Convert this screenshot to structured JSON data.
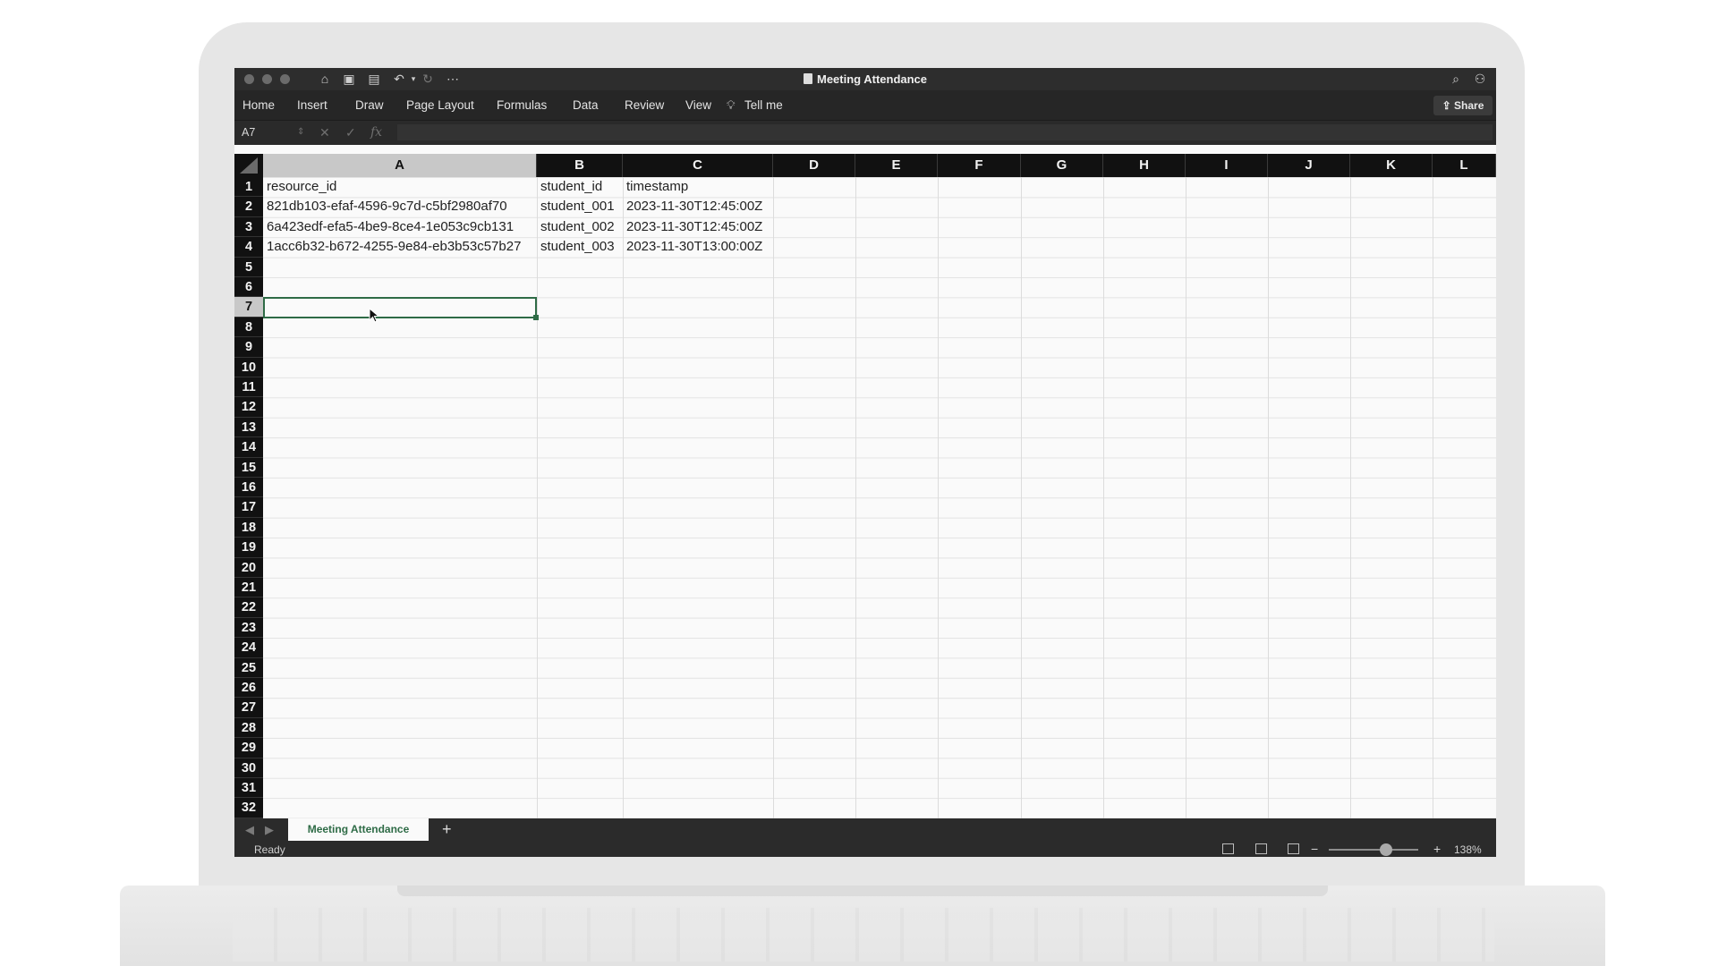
{
  "window": {
    "title": "Meeting Attendance"
  },
  "ribbon": {
    "tabs": [
      "Home",
      "Insert",
      "Draw",
      "Page Layout",
      "Formulas",
      "Data",
      "Review",
      "View"
    ],
    "tell_me": "Tell me",
    "share": "Share"
  },
  "formula_bar": {
    "name_box": "A7",
    "fx": "fx",
    "value": ""
  },
  "columns": [
    "A",
    "B",
    "C",
    "D",
    "E",
    "F",
    "G",
    "H",
    "I",
    "J",
    "K",
    "L"
  ],
  "selected_column": "A",
  "rows": [
    "1",
    "2",
    "3",
    "4",
    "5",
    "6",
    "7",
    "8",
    "9",
    "10",
    "11",
    "12",
    "13",
    "14",
    "15",
    "16",
    "17",
    "18",
    "19",
    "20",
    "21",
    "22",
    "23",
    "24",
    "25",
    "26",
    "27",
    "28",
    "29",
    "30",
    "31",
    "32"
  ],
  "selected_row": "7",
  "cells": {
    "A1": "resource_id",
    "B1": "student_id",
    "C1": "timestamp",
    "A2": "821db103-efaf-4596-9c7d-c5bf2980af70",
    "B2": "student_001",
    "C2": "2023-11-30T12:45:00Z",
    "A3": "6a423edf-efa5-4be9-8ce4-1e053c9cb131",
    "B3": "student_002",
    "C3": "2023-11-30T12:45:00Z",
    "A4": "1acc6b32-b672-4255-9e84-eb3b53c57b27",
    "B4": "student_003",
    "C4": "2023-11-30T13:00:00Z"
  },
  "sheets": {
    "active": "Meeting Attendance",
    "add": "+"
  },
  "status": {
    "text": "Ready",
    "zoom": "138%",
    "zoom_minus": "−",
    "zoom_plus": "+"
  },
  "colors": {
    "selection": "#2e6b46",
    "header_bg": "#111111"
  }
}
